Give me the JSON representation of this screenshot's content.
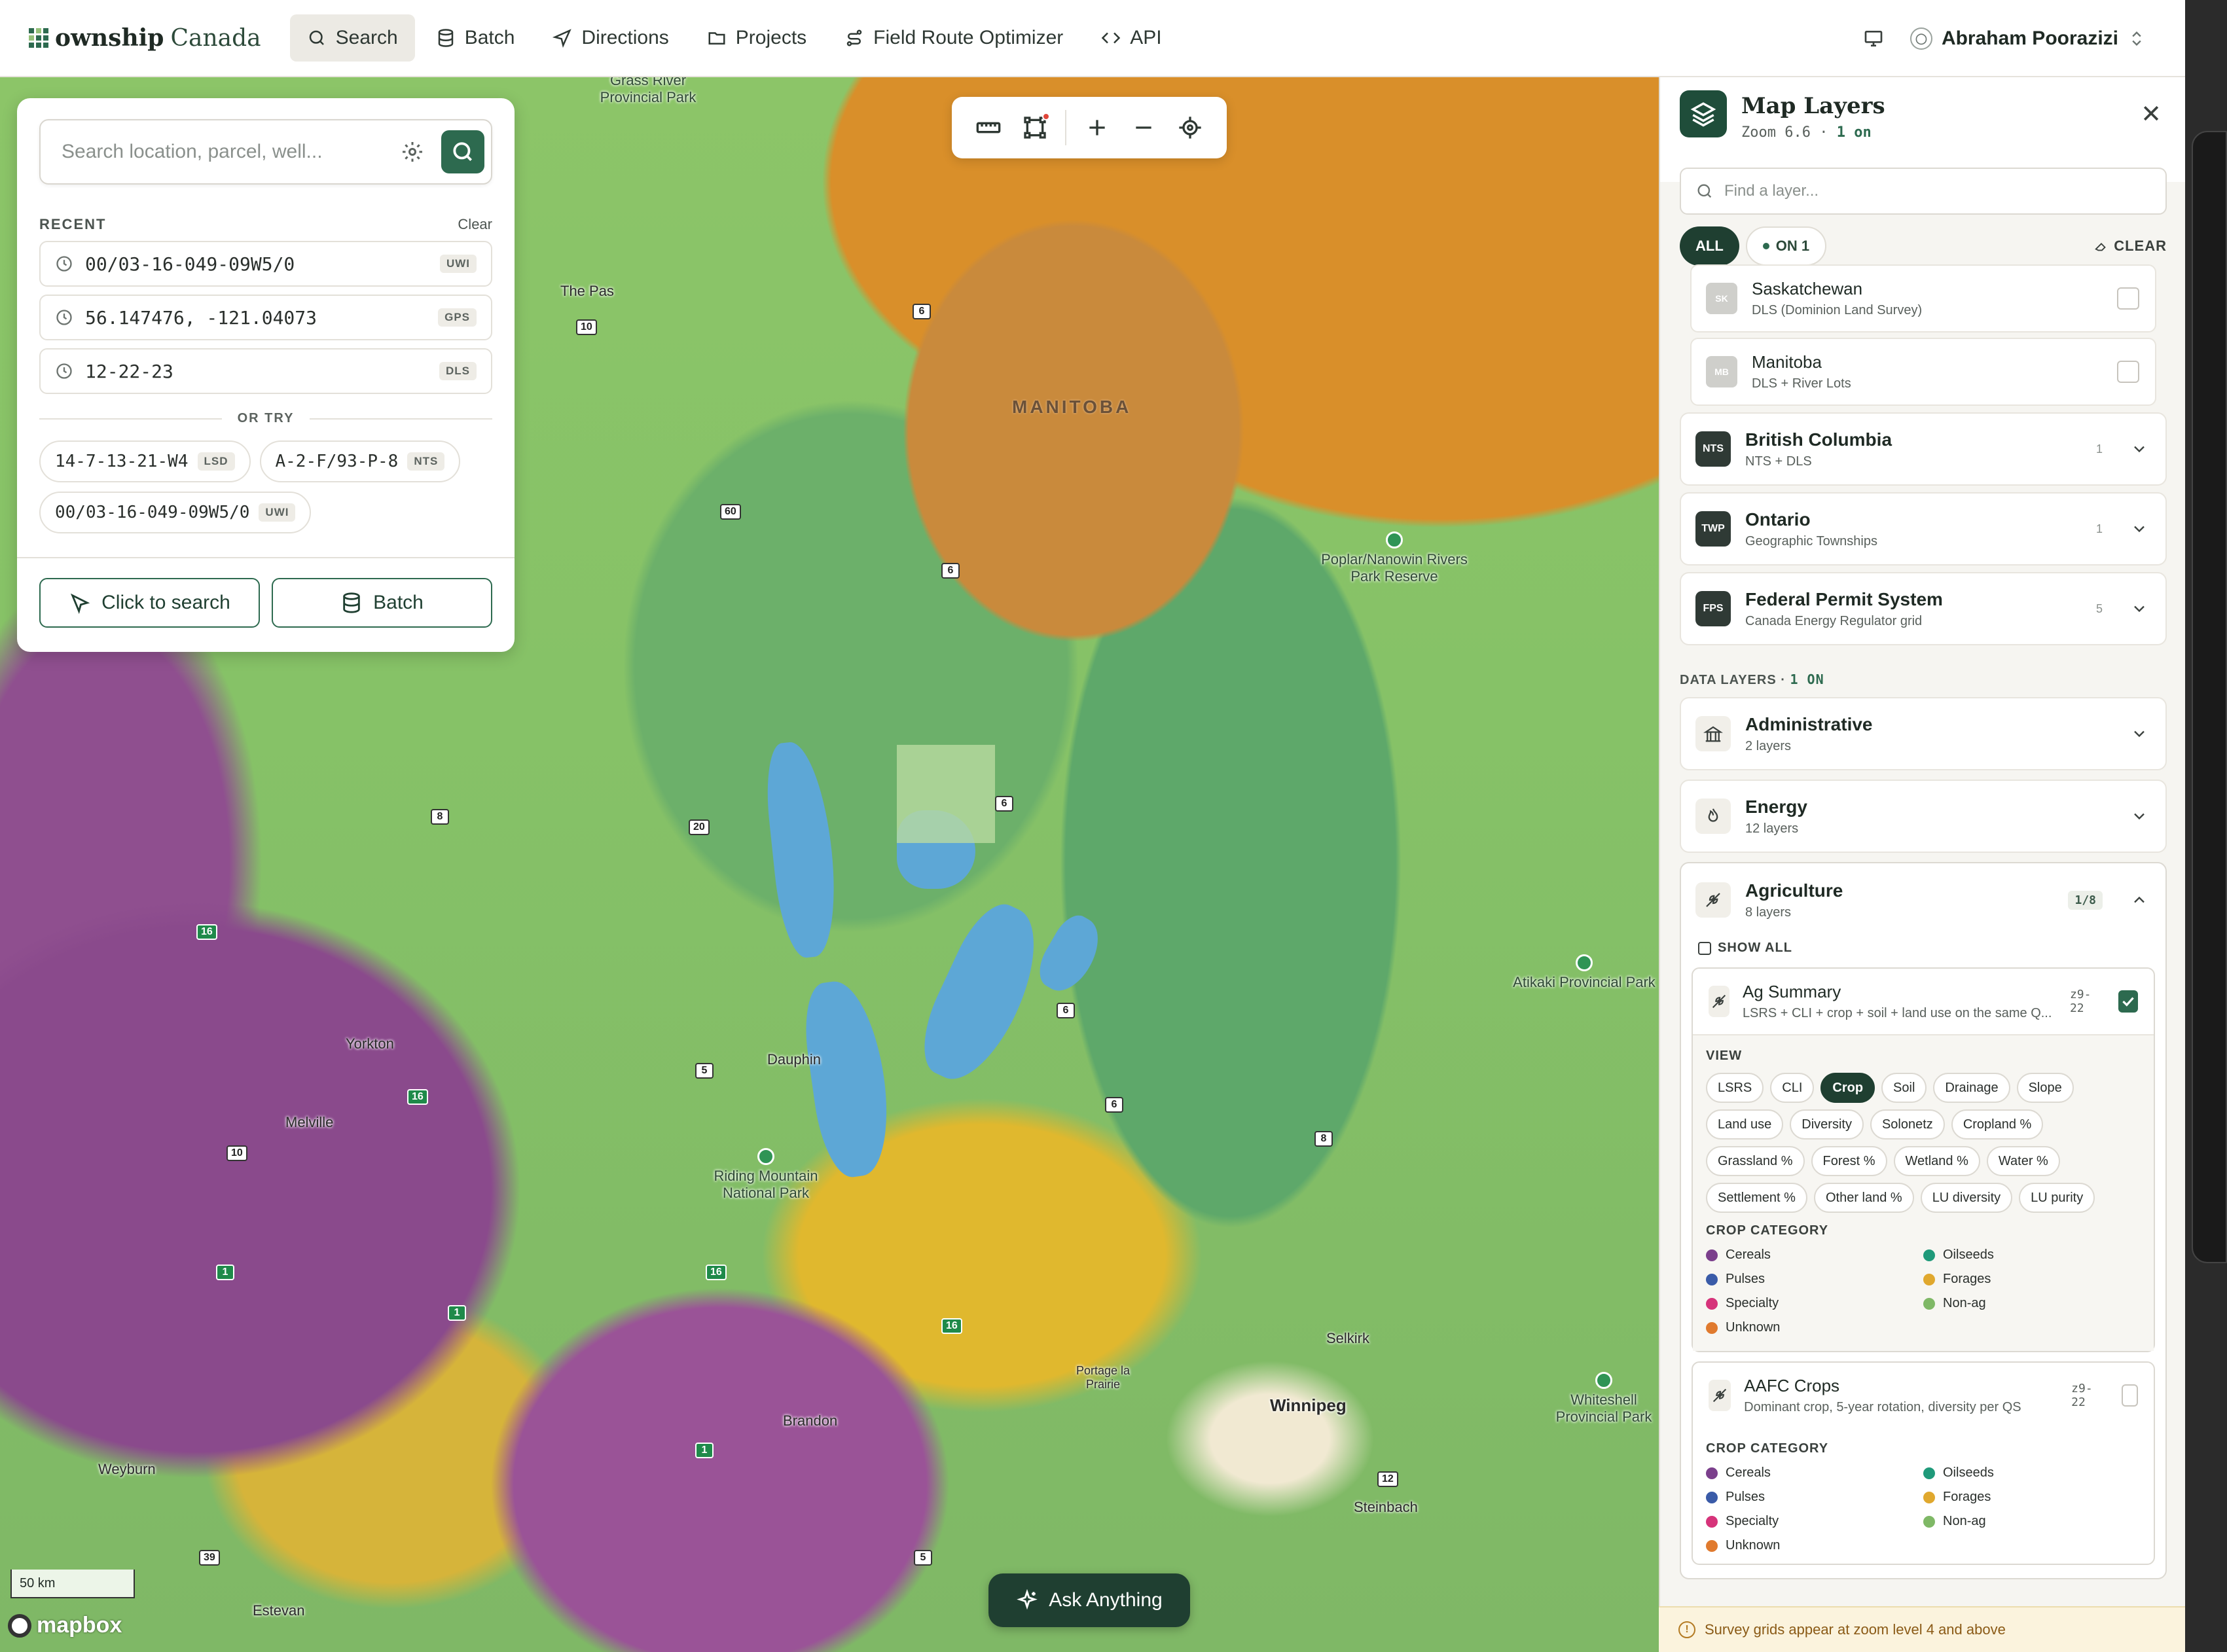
{
  "app": {
    "logo_text": "ownship",
    "logo_suffix": "Canada",
    "nav": [
      {
        "label": "Search",
        "icon": "search-icon",
        "active": true
      },
      {
        "label": "Batch",
        "icon": "database-icon",
        "active": false
      },
      {
        "label": "Directions",
        "icon": "navigation-icon",
        "active": false
      },
      {
        "label": "Projects",
        "icon": "folder-icon",
        "active": false
      },
      {
        "label": "Field Route Optimizer",
        "icon": "route-icon",
        "active": false
      },
      {
        "label": "API",
        "icon": "code-icon",
        "active": false
      }
    ],
    "user_name": "Abraham Poorazizi"
  },
  "search": {
    "placeholder": "Search location, parcel, well...",
    "recent_label": "RECENT",
    "clear_label": "Clear",
    "recent": [
      {
        "value": "00/03-16-049-09W5/0",
        "tag": "UWI"
      },
      {
        "value": "56.147476, -121.04073",
        "tag": "GPS"
      },
      {
        "value": "12-22-23",
        "tag": "DLS"
      }
    ],
    "or_try_label": "OR TRY",
    "examples": [
      {
        "value": "14-7-13-21-W4",
        "tag": "LSD"
      },
      {
        "value": "A-2-F/93-P-8",
        "tag": "NTS"
      },
      {
        "value": "00/03-16-049-09W5/0",
        "tag": "UWI"
      }
    ],
    "click_to_search": "Click to search",
    "batch": "Batch"
  },
  "map": {
    "province": "MANITOBA",
    "places": {
      "the_pas": "The Pas",
      "yorkton": "Yorkton",
      "melville": "Melville",
      "dauphin": "Dauphin",
      "brandon": "Brandon",
      "weyburn": "Weyburn",
      "estevan": "Estevan",
      "portage": "Portage la Prairie",
      "winnipeg": "Winnipeg",
      "selkirk": "Selkirk",
      "steinbach": "Steinbach"
    },
    "parks": {
      "clearwater": "Grass River Provincial Park",
      "poplar": "Poplar/Nanowin Rivers Park Reserve",
      "riding": "Riding Mountain National Park",
      "atikaki": "Atikaki Provincial Park",
      "whiteshell": "Whiteshell Provincial Park"
    },
    "highways": {
      "h6a": "6",
      "h10a": "10",
      "h60": "60",
      "h6b": "6",
      "h8a": "8",
      "h20": "20",
      "h6c": "6",
      "h16a": "16",
      "h16b": "16",
      "h5a": "5",
      "h10b": "10",
      "h6d": "6",
      "h6e": "6",
      "h8b": "8",
      "h1a": "1",
      "h1b": "1",
      "h16c": "16",
      "h16d": "16",
      "h1c": "1",
      "h12": "12",
      "h39": "39",
      "h5b": "5"
    },
    "scale": "50 km",
    "attribution": "mapbox",
    "ask_label": "Ask Anything"
  },
  "layers": {
    "title": "Map Layers",
    "zoom_text": "Zoom 6.6 ·",
    "on_text": "1 on",
    "find_placeholder": "Find a layer...",
    "filter_all": "ALL",
    "filter_on": "ON 1",
    "clear": "CLEAR",
    "sub_regions": [
      {
        "abbr": "SK",
        "title": "Saskatchewan",
        "subtitle": "DLS (Dominion Land Survey)"
      },
      {
        "abbr": "MB",
        "title": "Manitoba",
        "subtitle": "DLS + River Lots"
      }
    ],
    "groups": [
      {
        "abbr": "NTS",
        "title": "British Columbia",
        "subtitle": "NTS + DLS",
        "count": "1"
      },
      {
        "abbr": "TWP",
        "title": "Ontario",
        "subtitle": "Geographic Townships",
        "count": "1"
      },
      {
        "abbr": "FPS",
        "title": "Federal Permit System",
        "subtitle": "Canada Energy Regulator grid",
        "count": "5"
      }
    ],
    "data_layers_label": "DATA LAYERS ·",
    "data_layers_on": "1 ON",
    "categories": [
      {
        "title": "Administrative",
        "subtitle": "2 layers",
        "icon": "building-icon"
      },
      {
        "title": "Energy",
        "subtitle": "12 layers",
        "icon": "flame-icon"
      }
    ],
    "agriculture": {
      "title": "Agriculture",
      "subtitle": "8 layers",
      "badge": "1/8",
      "show_all": "SHOW ALL",
      "ag_summary": {
        "title": "Ag Summary",
        "subtitle": "LSRS + CLI + crop + soil + land use on the same Q...",
        "zoom": "z9-22",
        "checked": true,
        "view_label": "VIEW",
        "views": [
          "LSRS",
          "CLI",
          "Crop",
          "Soil",
          "Drainage",
          "Slope",
          "Land use",
          "Diversity",
          "Solonetz",
          "Cropland %",
          "Grassland %",
          "Forest %",
          "Wetland %",
          "Water %",
          "Settlement %",
          "Other land %",
          "LU diversity",
          "LU purity"
        ],
        "active_view": "Crop",
        "legend_label": "CROP CATEGORY",
        "legend": [
          {
            "label": "Cereals",
            "color": "#7b3f8c"
          },
          {
            "label": "Oilseeds",
            "color": "#1f9a7a"
          },
          {
            "label": "Pulses",
            "color": "#3a5ba8"
          },
          {
            "label": "Forages",
            "color": "#e0a82e"
          },
          {
            "label": "Specialty",
            "color": "#d6337a"
          },
          {
            "label": "Non-ag",
            "color": "#7fb866"
          },
          {
            "label": "Unknown",
            "color": "#e07a2e"
          }
        ]
      },
      "aafc": {
        "title": "AAFC Crops",
        "subtitle": "Dominant crop, 5-year rotation, diversity per QS",
        "zoom": "z9-22",
        "checked": false,
        "legend_label": "CROP CATEGORY",
        "legend": [
          {
            "label": "Cereals",
            "color": "#7b3f8c"
          },
          {
            "label": "Oilseeds",
            "color": "#1f9a7a"
          },
          {
            "label": "Pulses",
            "color": "#3a5ba8"
          },
          {
            "label": "Forages",
            "color": "#e0a82e"
          },
          {
            "label": "Specialty",
            "color": "#d6337a"
          },
          {
            "label": "Non-ag",
            "color": "#7fb866"
          },
          {
            "label": "Unknown",
            "color": "#e07a2e"
          }
        ]
      }
    },
    "footnote": "Survey grids appear at zoom level 4 and above"
  }
}
